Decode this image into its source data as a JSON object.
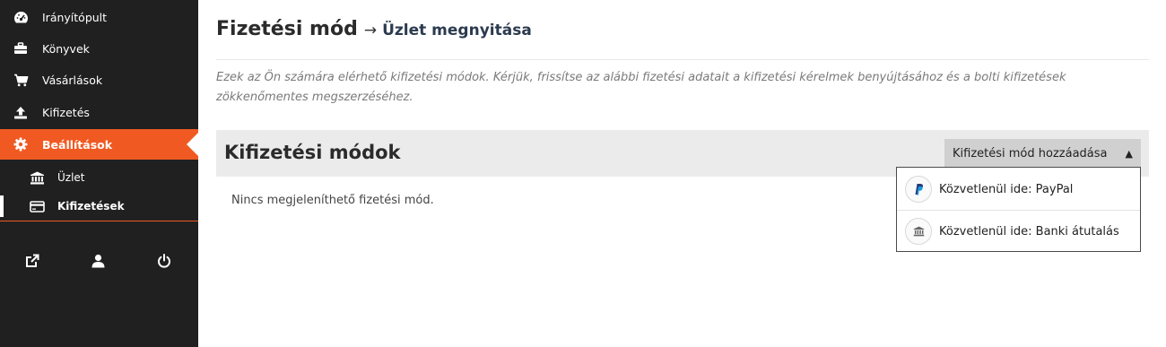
{
  "sidebar": {
    "items": [
      {
        "label": "Irányítópult",
        "icon": "dashboard-icon"
      },
      {
        "label": "Könyvek",
        "icon": "briefcase-icon"
      },
      {
        "label": "Vásárlások",
        "icon": "cart-icon"
      },
      {
        "label": "Kifizetés",
        "icon": "upload-icon"
      },
      {
        "label": "Beállítások",
        "icon": "gear-icon",
        "active": true
      }
    ],
    "subitems": [
      {
        "label": "Üzlet",
        "icon": "bank-icon"
      },
      {
        "label": "Kifizetések",
        "icon": "credit-card-icon",
        "active": true
      }
    ],
    "bottom_icons": [
      "external-link-icon",
      "user-icon",
      "power-icon"
    ],
    "accent_color": "#f05a22",
    "background_color": "#202020"
  },
  "main": {
    "title": "Fizetési mód",
    "arrow": "→",
    "subtitle": "Üzlet megnyitása",
    "intro": "Ezek az Ön számára elérhető kifizetési módok. Kérjük, frissítse az alábbi fizetési adatait a kifizetési kérelmek benyújtásához és a bolti kifizetések zökkenőmentes megszerzéséhez.",
    "section_title": "Kifizetési módok",
    "add_button_label": "Kifizetési mód hozzáadása",
    "add_button_caret": "▲",
    "empty_message": "Nincs megjeleníthető fizetési mód."
  },
  "dropdown": {
    "items": [
      {
        "label": "Közvetlenül ide: PayPal",
        "icon": "paypal-icon"
      },
      {
        "label": "Közvetlenül ide: Banki átutalás",
        "icon": "bank-icon"
      }
    ]
  }
}
